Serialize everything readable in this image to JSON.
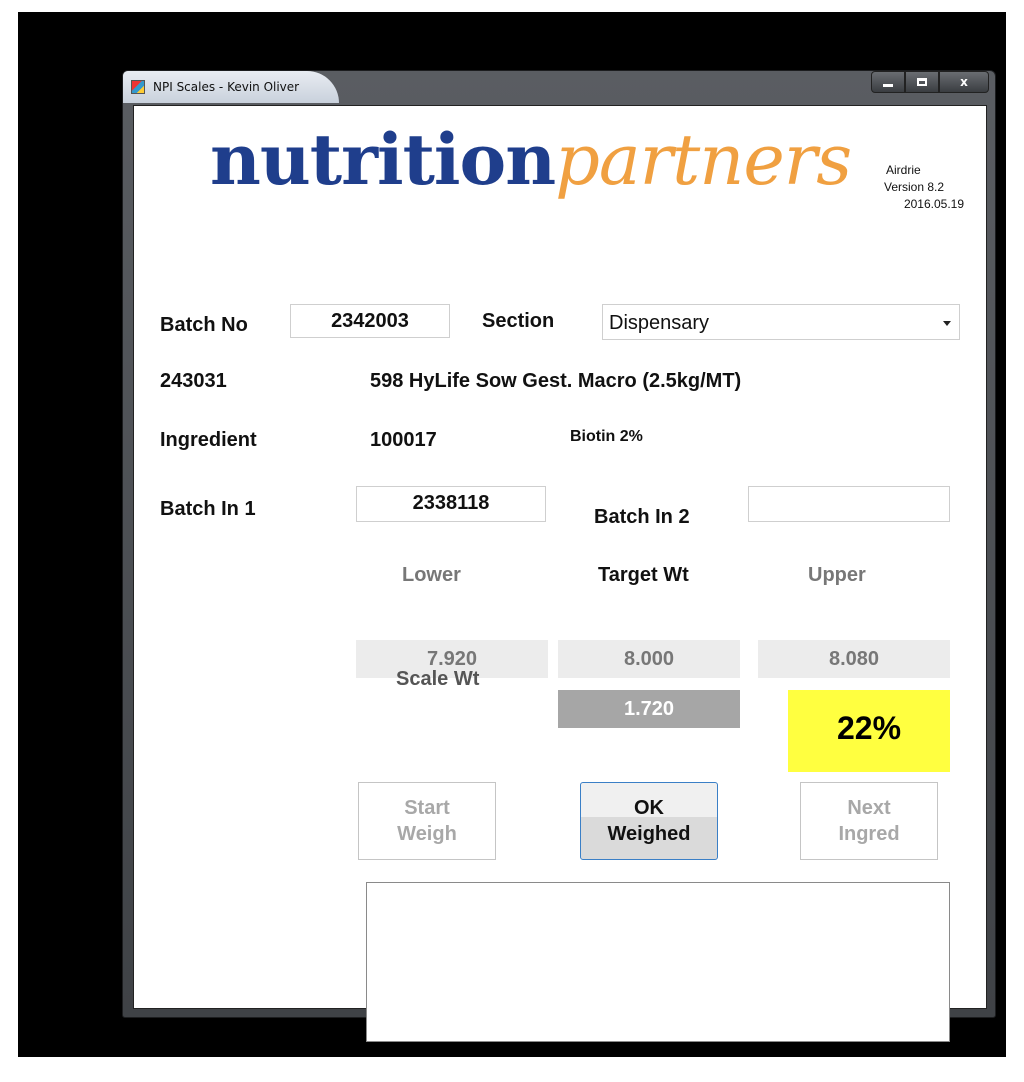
{
  "window": {
    "title": "NPI Scales - Kevin Oliver",
    "minimize": "minimize",
    "maximize": "maximize",
    "close": "x"
  },
  "logo": {
    "part1": "nutrition",
    "part2": "partners"
  },
  "site": {
    "location": "Airdrie",
    "version": "Version 8.2",
    "date": "2016.05.19"
  },
  "batch": {
    "label": "Batch No",
    "value": "2342003"
  },
  "section": {
    "label": "Section",
    "value": "Dispensary",
    "options": [
      "Dispensary"
    ]
  },
  "product": {
    "code": "243031",
    "name": "598 HyLife Sow Gest. Macro (2.5kg/MT)"
  },
  "ingredient": {
    "label": "Ingredient",
    "code": "100017",
    "name": "Biotin 2%"
  },
  "batch_in_1": {
    "label": "Batch In 1",
    "value": "2338118"
  },
  "batch_in_2": {
    "label": "Batch In 2",
    "value": ""
  },
  "weights": {
    "lower_label": "Lower",
    "target_label": "Target Wt",
    "upper_label": "Upper",
    "lower": "7.920",
    "target": "8.000",
    "upper": "8.080",
    "scale_label": "Scale Wt",
    "scale": "1.720",
    "percent": "22%"
  },
  "buttons": {
    "start_line1": "Start",
    "start_line2": "Weigh",
    "ok_line1": "OK",
    "ok_line2": "Weighed",
    "next_line1": "Next",
    "next_line2": "Ingred"
  },
  "colors": {
    "logo_dark": "#1f3e8c",
    "logo_light": "#f0a041",
    "percent_bg": "#ffff40",
    "scale_bg": "#a6a6a6"
  }
}
